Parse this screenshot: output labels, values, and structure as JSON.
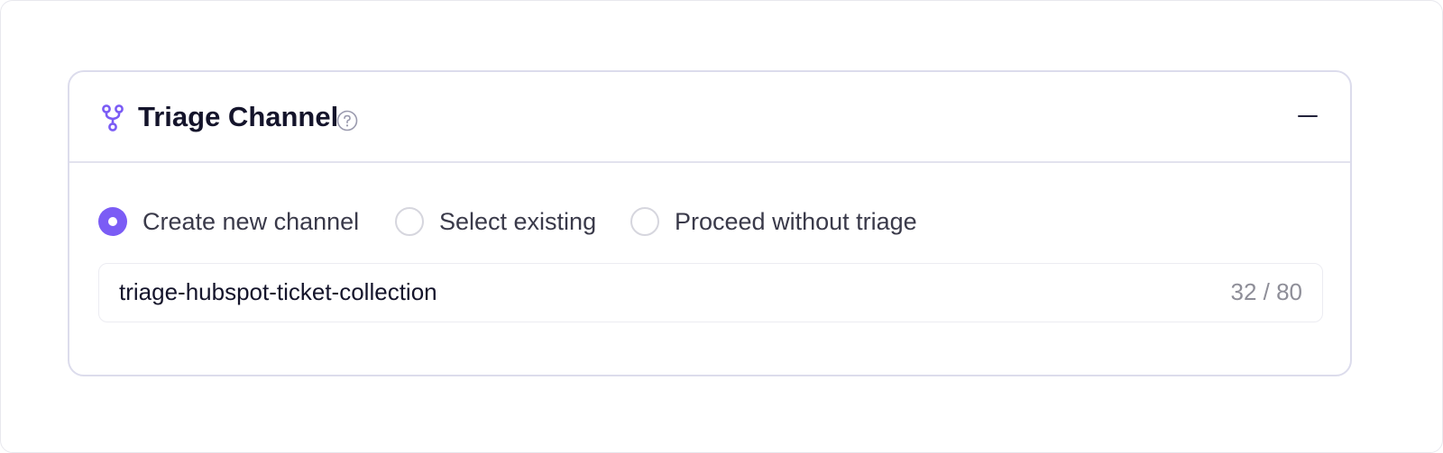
{
  "triage_panel": {
    "title": "Triage Channel",
    "header_icon": "branch-icon",
    "help_icon": "question-circle-icon",
    "collapse_icon": "minus-icon",
    "accent_color": "#7B5CF5",
    "options": [
      {
        "label": "Create new channel",
        "checked": true
      },
      {
        "label": "Select existing",
        "checked": false
      },
      {
        "label": "Proceed without triage",
        "checked": false
      }
    ],
    "channel_name": {
      "value": "triage-hubspot-ticket-collection",
      "placeholder": "",
      "counter": "32 / 80"
    }
  }
}
